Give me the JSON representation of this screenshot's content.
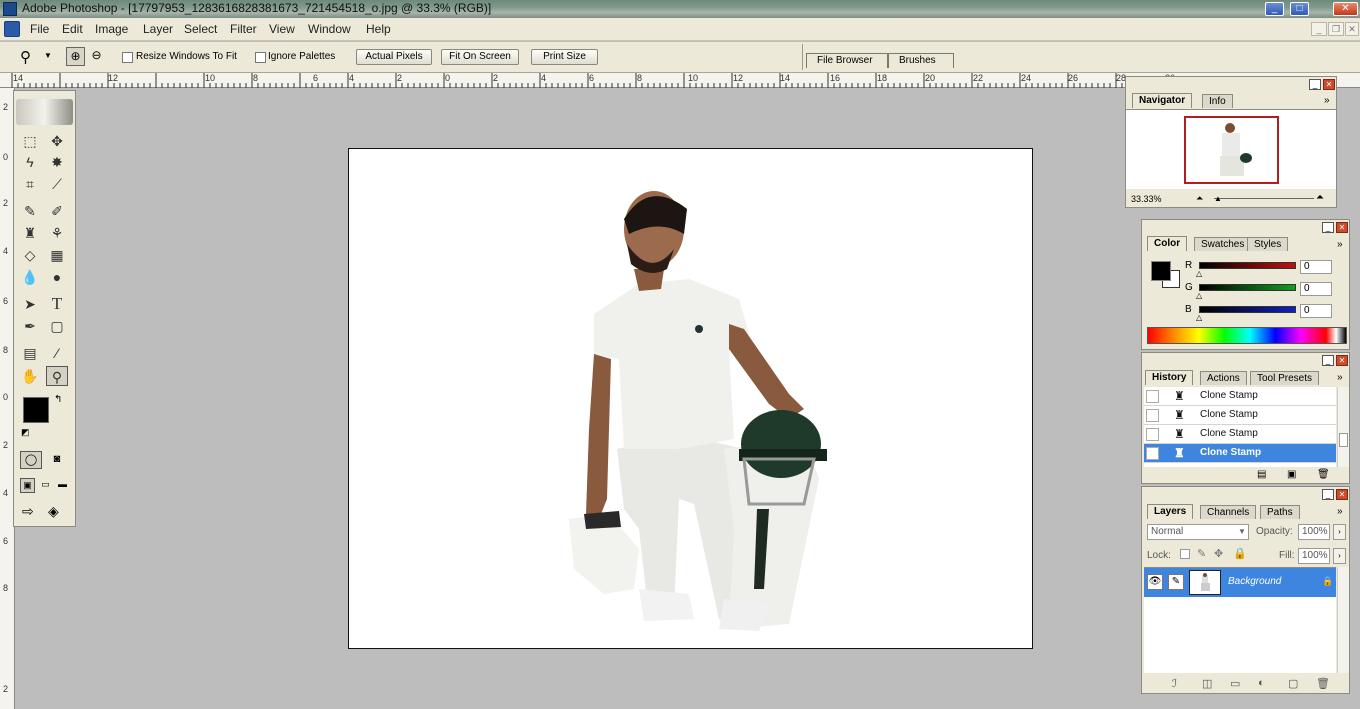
{
  "titlebar": {
    "title": "Adobe Photoshop - [17797953_1283616828381673_721454518_o.jpg @ 33.3% (RGB)]"
  },
  "menubar": {
    "items": [
      "File",
      "Edit",
      "Image",
      "Layer",
      "Select",
      "Filter",
      "View",
      "Window",
      "Help"
    ]
  },
  "options": {
    "resize_windows": "Resize Windows To Fit",
    "ignore_palettes": "Ignore Palettes",
    "actual_pixels": "Actual Pixels",
    "fit_on_screen": "Fit On Screen",
    "print_size": "Print Size"
  },
  "palette_well": {
    "tabs": [
      "File Browser",
      "Brushes"
    ]
  },
  "ruler": {
    "top": [
      "14",
      "12",
      "10",
      "8",
      "6",
      "4",
      "2",
      "0",
      "2",
      "4",
      "6",
      "8",
      "10",
      "12",
      "14",
      "16",
      "18",
      "20",
      "22",
      "24",
      "26",
      "28",
      "30"
    ],
    "left": [
      "2",
      "0",
      "2",
      "4",
      "6",
      "8",
      "0",
      "2",
      "4",
      "6",
      "8",
      "2"
    ]
  },
  "navigator": {
    "tabs": [
      "Navigator",
      "Info"
    ],
    "zoom": "33.33%"
  },
  "color": {
    "tabs": [
      "Color",
      "Swatches",
      "Styles"
    ],
    "channels": [
      {
        "label": "R",
        "value": "0"
      },
      {
        "label": "G",
        "value": "0"
      },
      {
        "label": "B",
        "value": "0"
      }
    ],
    "colors": {
      "r": "#c01010",
      "g": "#10a020",
      "b": "#1020c0",
      "fg": "#000000",
      "bg": "#ffffff"
    }
  },
  "history": {
    "tabs": [
      "History",
      "Actions",
      "Tool Presets"
    ],
    "items": [
      "Clone Stamp",
      "Clone Stamp",
      "Clone Stamp",
      "Clone Stamp"
    ]
  },
  "layers": {
    "tabs": [
      "Layers",
      "Channels",
      "Paths"
    ],
    "blend_mode": "Normal",
    "opacity_label": "Opacity:",
    "opacity": "100%",
    "lock_label": "Lock:",
    "fill_label": "Fill:",
    "fill": "100%",
    "layer_name": "Background"
  },
  "accent": "#3d85de"
}
